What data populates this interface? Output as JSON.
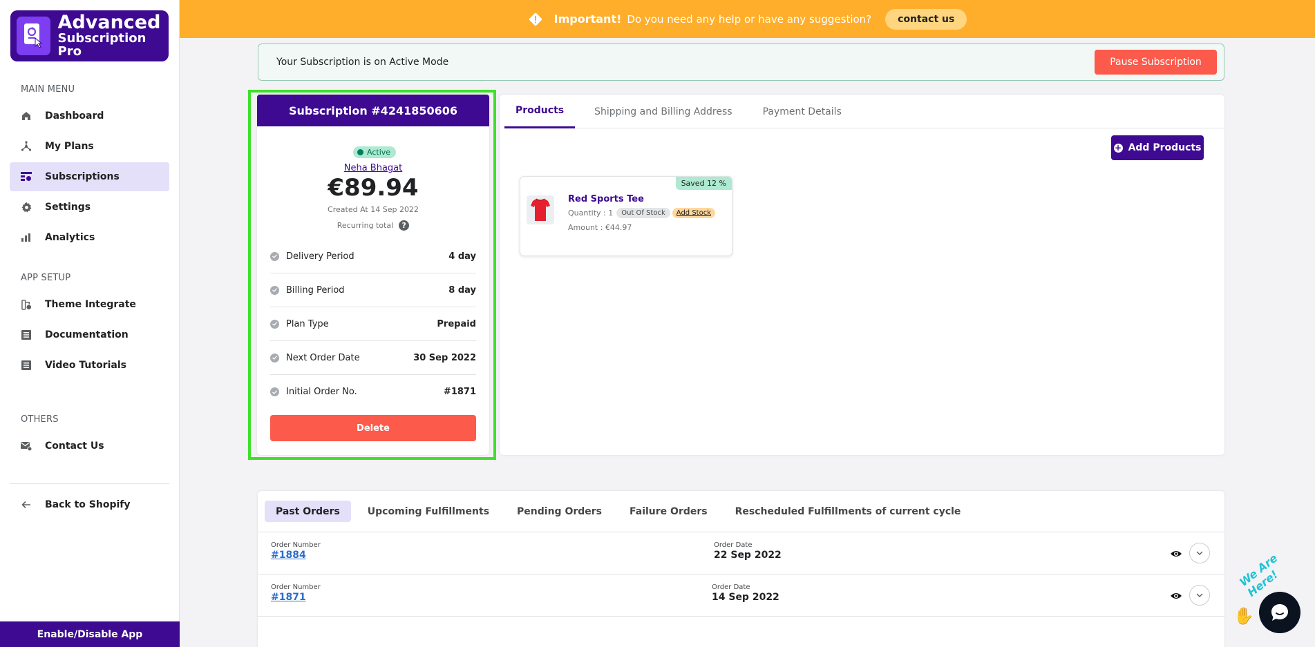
{
  "app": {
    "logo_line1": "Advanced",
    "logo_line2": "Subscription Pro"
  },
  "sidebar": {
    "main_menu_heading": "MAIN MENU",
    "main_items": [
      {
        "label": "Dashboard",
        "icon": "home-icon"
      },
      {
        "label": "My Plans",
        "icon": "plans-icon"
      },
      {
        "label": "Subscriptions",
        "icon": "subscriptions-icon",
        "active": true
      },
      {
        "label": "Settings",
        "icon": "gear-icon"
      },
      {
        "label": "Analytics",
        "icon": "bar-chart-icon"
      }
    ],
    "app_setup_heading": "APP SETUP",
    "setup_items": [
      {
        "label": "Theme Integrate",
        "icon": "theme-icon"
      },
      {
        "label": "Documentation",
        "icon": "document-icon"
      },
      {
        "label": "Video Tutorials",
        "icon": "video-list-icon"
      }
    ],
    "others_heading": "OTHERS",
    "other_items": [
      {
        "label": "Contact Us",
        "icon": "mail-icon"
      }
    ],
    "back_label": "Back to Shopify",
    "enable_label": "Enable/Disable App"
  },
  "banner": {
    "important": "Important!",
    "message": "Do you need any help or have any suggestion?",
    "contact_label": "contact us",
    "color": "#ffae2b"
  },
  "status": {
    "message": "Your Subscription is on Active Mode",
    "pause_label": "Pause Subscription"
  },
  "subscription": {
    "title": "Subscription #4241850606",
    "status": "Active",
    "customer": "Neha Bhagat",
    "price": "€89.94",
    "created": "Created At 14 Sep 2022",
    "recurring_label": "Recurring total",
    "details": [
      {
        "label": "Delivery Period",
        "value": "4 day"
      },
      {
        "label": "Billing Period",
        "value": "8 day"
      },
      {
        "label": "Plan Type",
        "value": "Prepaid"
      },
      {
        "label": "Next Order Date",
        "value": "30 Sep 2022"
      },
      {
        "label": "Initial Order No.",
        "value": "#1871"
      }
    ],
    "delete_label": "Delete"
  },
  "tabs": [
    {
      "label": "Products",
      "active": true
    },
    {
      "label": "Shipping and Billing Address"
    },
    {
      "label": "Payment Details"
    }
  ],
  "products_panel": {
    "add_label": "Add Products",
    "items": [
      {
        "name": "Red Sports Tee",
        "quantity": "Quantity : 1",
        "stock_badge": "Out Of Stock",
        "add_stock": "Add Stock",
        "amount": "Amount : €44.97",
        "saved": "Saved 12 %"
      }
    ]
  },
  "orders": {
    "tabs": [
      {
        "label": "Past Orders",
        "active": true
      },
      {
        "label": "Upcoming Fulfillments"
      },
      {
        "label": "Pending Orders"
      },
      {
        "label": "Failure Orders"
      },
      {
        "label": "Rescheduled Fulfillments of current cycle"
      }
    ],
    "number_header": "Order Number",
    "date_header": "Order Date",
    "rows": [
      {
        "number": "#1884",
        "date": "22 Sep 2022"
      },
      {
        "number": "#1871",
        "date": "14 Sep 2022"
      }
    ]
  },
  "chat": {
    "label": "We Are Here!"
  },
  "colors": {
    "brand": "#3d0a91",
    "danger": "#fc5a4a",
    "highlight": "#3fe02b"
  }
}
